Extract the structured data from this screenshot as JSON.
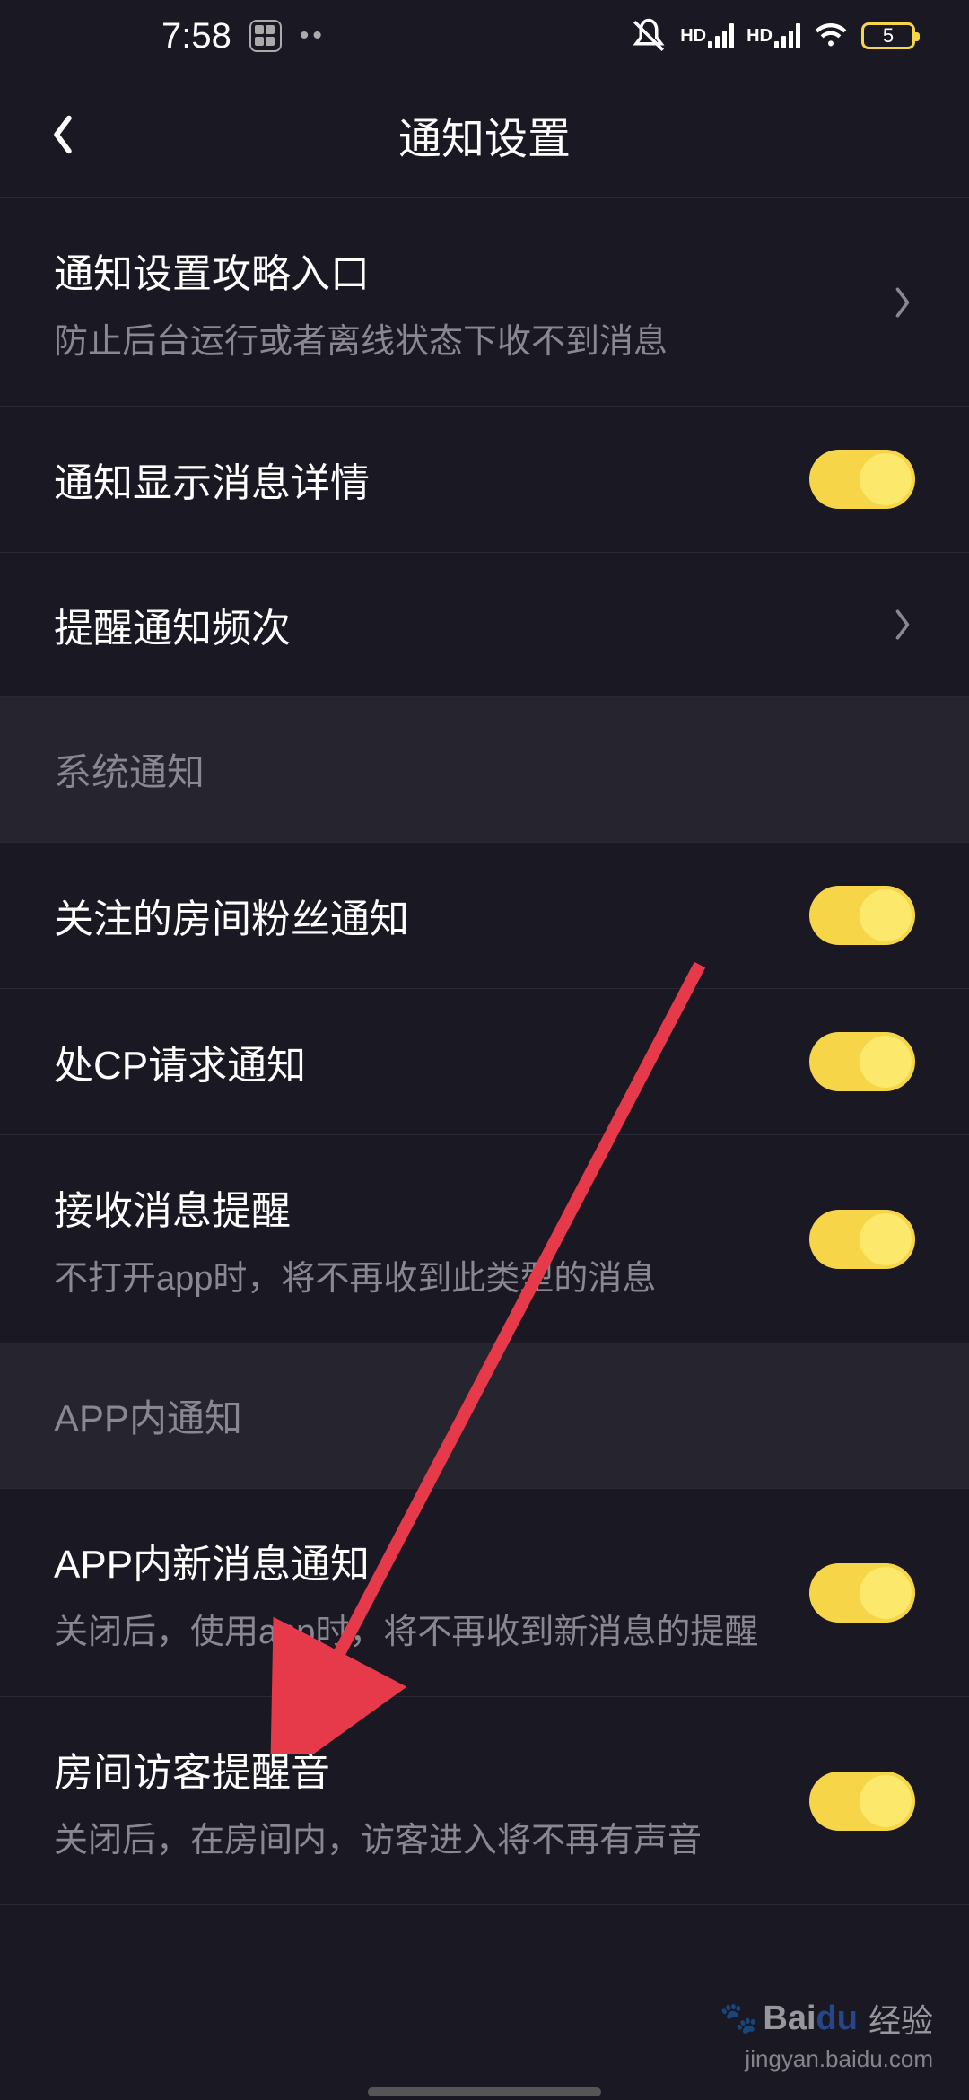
{
  "statusBar": {
    "time": "7:58",
    "signalLabel": "HD",
    "batteryLevel": "5"
  },
  "nav": {
    "title": "通知设置"
  },
  "items": {
    "guide": {
      "title": "通知设置攻略入口",
      "subtitle": "防止后台运行或者离线状态下收不到消息"
    },
    "showDetail": {
      "title": "通知显示消息详情"
    },
    "frequency": {
      "title": "提醒通知频次"
    },
    "sectionSystem": "系统通知",
    "followRoom": {
      "title": "关注的房间粉丝通知"
    },
    "cpRequest": {
      "title": "处CP请求通知"
    },
    "receiveMessage": {
      "title": "接收消息提醒",
      "subtitle": "不打开app时，将不再收到此类型的消息"
    },
    "sectionApp": "APP内通知",
    "inAppNewMessage": {
      "title": "APP内新消息通知",
      "subtitle": "关闭后，使用app时，将不再收到新消息的提醒"
    },
    "roomVisitorSound": {
      "title": "房间访客提醒音",
      "subtitle": "关闭后，在房间内，访客进入将不再有声音"
    }
  },
  "watermark": {
    "brand1": "Bai",
    "brand2": "du",
    "label": "经验",
    "url": "jingyan.baidu.com"
  }
}
